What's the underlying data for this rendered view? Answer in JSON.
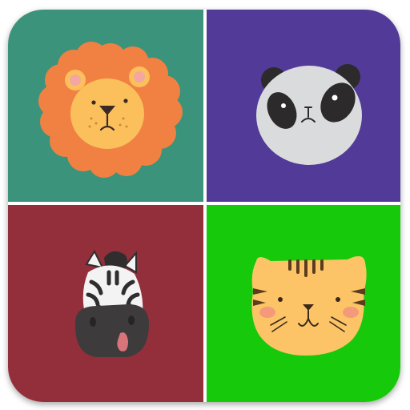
{
  "app_icon": {
    "tiles": [
      {
        "animal": "lion",
        "background": "#3a937a",
        "icon": "lion-face-icon"
      },
      {
        "animal": "panda",
        "background": "#523a98",
        "icon": "panda-face-icon"
      },
      {
        "animal": "zebra",
        "background": "#932f3b",
        "icon": "zebra-face-icon"
      },
      {
        "animal": "tiger",
        "background": "#17c90b",
        "icon": "tiger-face-icon"
      }
    ],
    "colors": {
      "frame_border": "#ffffff",
      "lion_mane": "#f08142",
      "lion_face": "#fbc05c",
      "panda_face": "#d9dbdc",
      "panda_patches": "#2d2a2b",
      "zebra_muzzle": "#3d3b3c",
      "zebra_tongue": "#d9747a",
      "tiger_face": "#fcc466",
      "tiger_stripes": "#5b3d1e"
    }
  }
}
